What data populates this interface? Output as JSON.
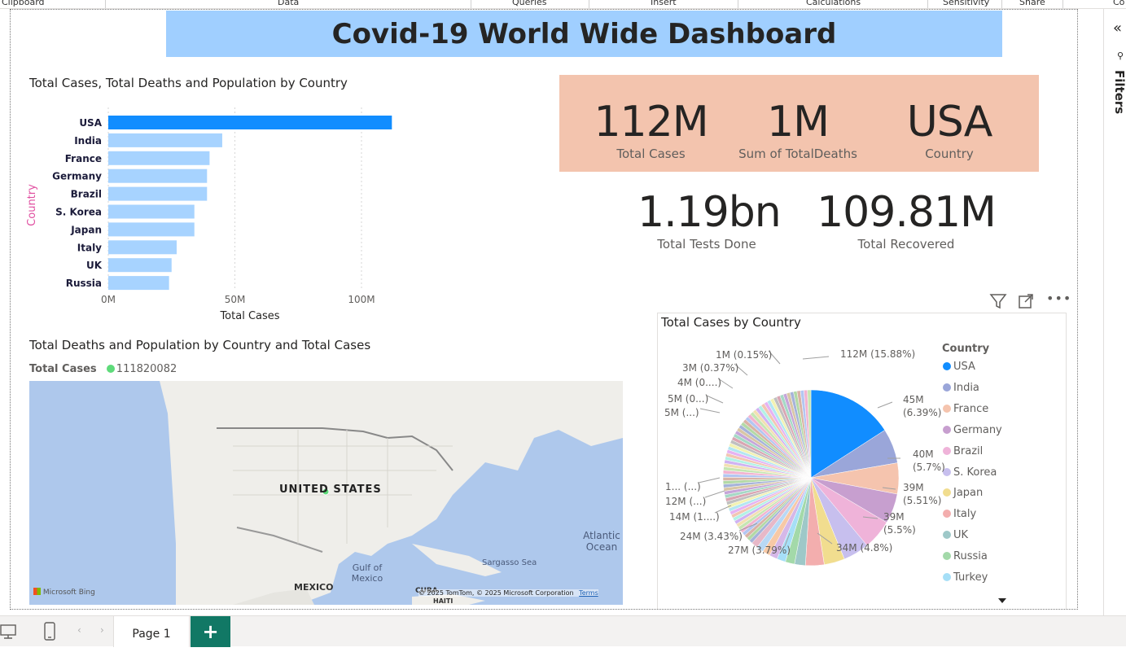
{
  "ribbon": {
    "groups": [
      "Clipboard",
      "Data",
      "Queries",
      "Insert",
      "Calculations",
      "Sensitivity",
      "Share",
      "Co"
    ]
  },
  "dashboard": {
    "title": "Covid-19 World Wide Dashboard"
  },
  "kpis": {
    "total_cases": {
      "value": "112M",
      "label": "Total Cases"
    },
    "total_deaths": {
      "value": "1M",
      "label": "Sum of TotalDeaths"
    },
    "country": {
      "value": "USA",
      "label": "Country"
    },
    "tests": {
      "value": "1.19bn",
      "label": "Total Tests Done"
    },
    "recovered": {
      "value": "109.81M",
      "label": "Total Recovered"
    }
  },
  "bar_visual": {
    "title": "Total Cases, Total Deaths and Population by Country",
    "ylabel": "Country",
    "xlabel": "Total Cases",
    "ticks": [
      "0M",
      "50M",
      "100M"
    ],
    "colors": {
      "selected": "#118dff",
      "default": "#a7d3ff"
    }
  },
  "map_visual": {
    "title": "Total Deaths and Population by Country and Total Cases",
    "legend_label": "Total Cases",
    "legend_value": "111820082",
    "labels": {
      "country": "UNITED STATES",
      "mexico": "MEXICO",
      "gulf": "Gulf of Mexico",
      "atlantic": "Atlantic Ocean",
      "sargasso": "Sargasso Sea",
      "cuba": "CUBA",
      "haiti": "HAITI",
      "provider": "Microsoft Bing",
      "copyright": "© 2025 TomTom, © 2025 Microsoft Corporation",
      "terms": "Terms"
    }
  },
  "pie_visual": {
    "title": "Total Cases by Country",
    "legend_title": "Country",
    "legend": [
      {
        "name": "USA",
        "color": "#118dff"
      },
      {
        "name": "India",
        "color": "#9aa6d9"
      },
      {
        "name": "France",
        "color": "#f5c4ae"
      },
      {
        "name": "Germany",
        "color": "#c79fcf"
      },
      {
        "name": "Brazil",
        "color": "#efb3d9"
      },
      {
        "name": "S. Korea",
        "color": "#c7bfee"
      },
      {
        "name": "Japan",
        "color": "#f1dd8f"
      },
      {
        "name": "Italy",
        "color": "#f3aeae"
      },
      {
        "name": "UK",
        "color": "#9ec8c8"
      },
      {
        "name": "Russia",
        "color": "#a3d9a9"
      },
      {
        "name": "Turkey",
        "color": "#a6dff7"
      }
    ],
    "slice_labels": [
      "112M (15.88%)",
      "45M",
      "(6.39%)",
      "40M",
      "(5.7%)",
      "39M",
      "(5.51%)",
      "39M",
      "(5.5%)",
      "34M (4.8%)",
      "27M (3.79%)",
      "24M (3.43%)",
      "14M (1....)",
      "12M (...)",
      "1... (...)",
      "5M (...)",
      "5M (0...)",
      "4M (0....)",
      "3M (0.37%)",
      "1M (0.15%)"
    ]
  },
  "chart_data": {
    "type": "bar",
    "title": "Total Cases, Total Deaths and Population by Country",
    "xlabel": "Total Cases",
    "ylabel": "Country",
    "categories": [
      "USA",
      "India",
      "France",
      "Germany",
      "Brazil",
      "S. Korea",
      "Japan",
      "Italy",
      "UK",
      "Russia"
    ],
    "values": [
      112,
      45,
      40,
      39,
      39,
      34,
      34,
      27,
      25,
      24
    ],
    "xlim": [
      0,
      112
    ],
    "unit": "M",
    "grid": true
  },
  "bottom": {
    "page_tab": "Page 1",
    "add_page": "+"
  }
}
